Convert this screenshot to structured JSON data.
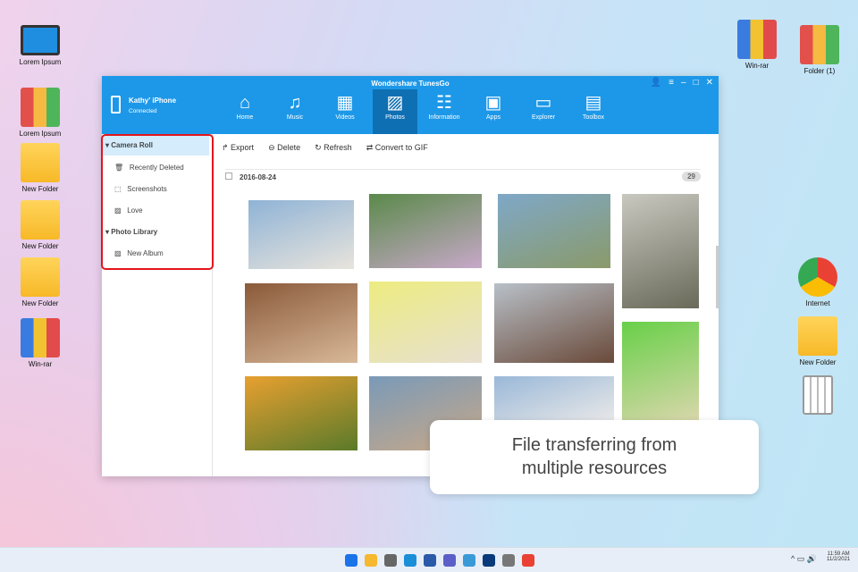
{
  "desktop": {
    "left": [
      "Lorem Ipsum",
      "Lorem Ipsum",
      "New Folder",
      "New Folder",
      "New Folder",
      "Win-rar"
    ],
    "right_top": [
      "Win-rar",
      "Folder (1)"
    ],
    "right_mid": [
      "Internet",
      "New Folder"
    ]
  },
  "app": {
    "title": "Wondershare TunesGo",
    "device_name": "Kathy' iPhone",
    "device_status": "Connected",
    "tabs": [
      {
        "label": "Home",
        "icon": "⌂"
      },
      {
        "label": "Music",
        "icon": "♫"
      },
      {
        "label": "Videos",
        "icon": "▦"
      },
      {
        "label": "Photos",
        "icon": "▨"
      },
      {
        "label": "Information",
        "icon": "☷"
      },
      {
        "label": "Apps",
        "icon": "▣"
      },
      {
        "label": "Explorer",
        "icon": "▭"
      },
      {
        "label": "Toolbox",
        "icon": "▤"
      }
    ],
    "sidebar": {
      "camera_roll": "Camera Roll",
      "items": [
        "Recently Deleted",
        "Screenshots",
        "Love"
      ],
      "photo_library": "Photo Library",
      "library_items": [
        "New Album"
      ]
    },
    "toolbar": {
      "export": "Export",
      "delete": "Delete",
      "refresh": "Refresh",
      "convert": "Convert to GIF"
    },
    "date": "2016-08-24",
    "count": "29"
  },
  "callout": {
    "line1": "File transferring from",
    "line2": "multiple resources"
  },
  "taskbar": {
    "time": "11:59 AM",
    "date": "11/2/2021"
  }
}
